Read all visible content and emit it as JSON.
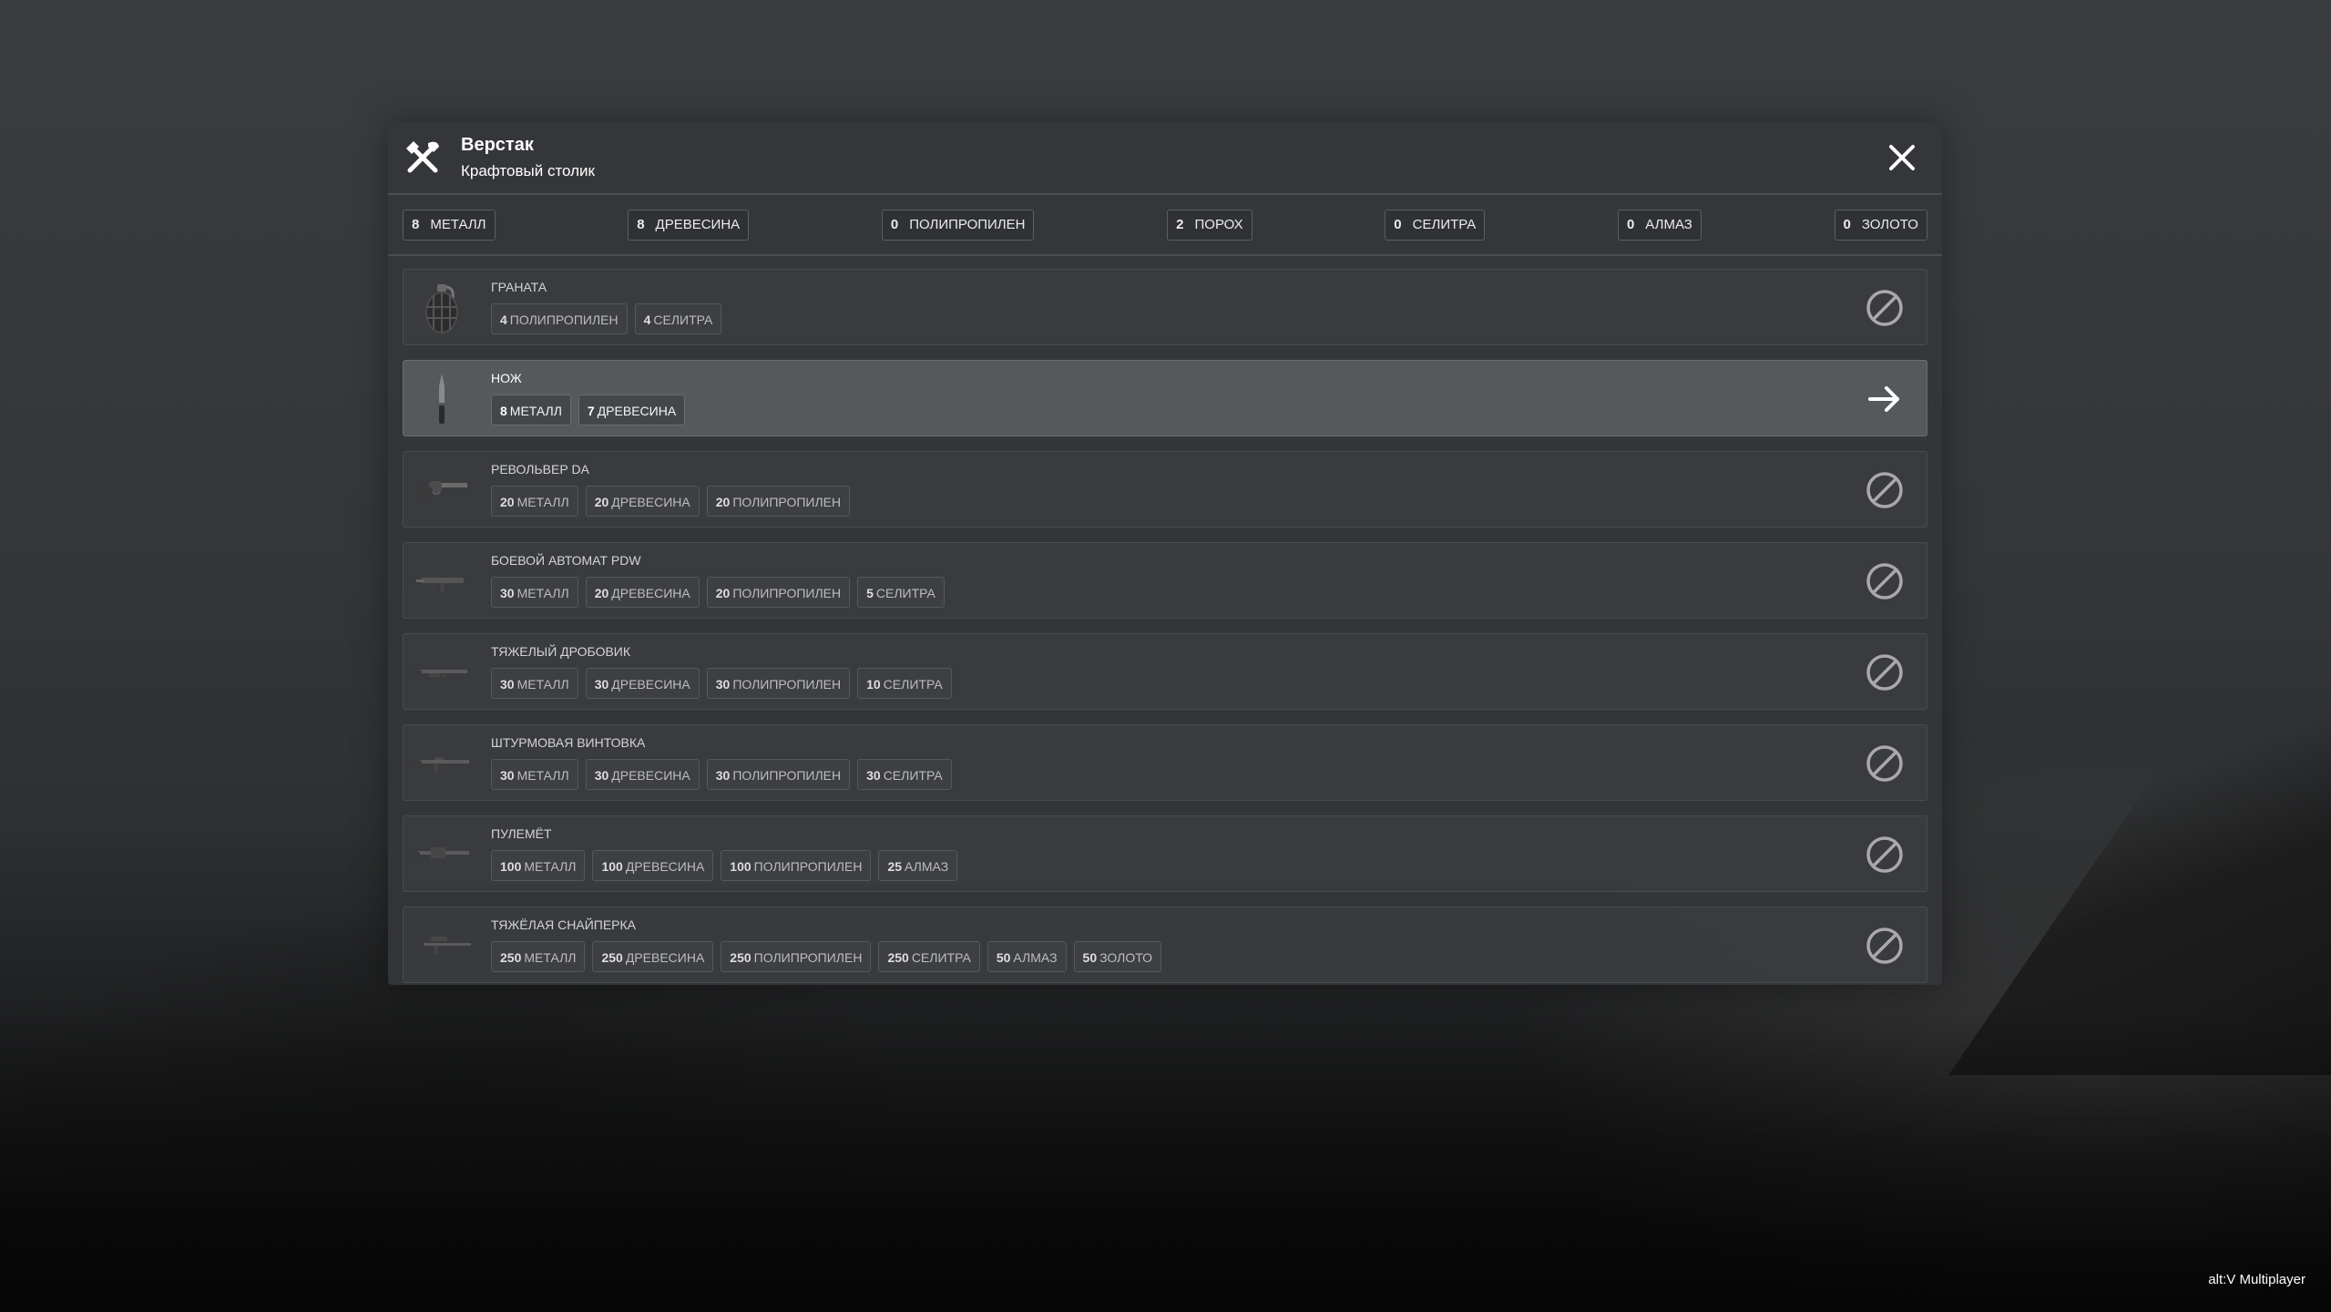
{
  "header": {
    "title": "Верстак",
    "subtitle": "Крафтовый столик",
    "icon": "tools-icon",
    "close_icon": "close-icon"
  },
  "resources": [
    {
      "count": "8",
      "label": "МЕТАЛЛ"
    },
    {
      "count": "8",
      "label": "ДРЕВЕСИНА"
    },
    {
      "count": "0",
      "label": "ПОЛИПРОПИЛЕН"
    },
    {
      "count": "2",
      "label": "ПОРОХ"
    },
    {
      "count": "0",
      "label": "СЕЛИТРА"
    },
    {
      "count": "0",
      "label": "АЛМАЗ"
    },
    {
      "count": "0",
      "label": "ЗОЛОТО"
    }
  ],
  "recipes": [
    {
      "name": "ГРАНАТА",
      "icon": "grenade-icon",
      "craftable": false,
      "costs": [
        {
          "amount": "4",
          "label": "ПОЛИПРОПИЛЕН"
        },
        {
          "amount": "4",
          "label": "СЕЛИТРА"
        }
      ]
    },
    {
      "name": "НОЖ",
      "icon": "knife-icon",
      "craftable": true,
      "costs": [
        {
          "amount": "8",
          "label": "МЕТАЛЛ"
        },
        {
          "amount": "7",
          "label": "ДРЕВЕСИНА"
        }
      ]
    },
    {
      "name": "РЕВОЛЬВЕР DA",
      "icon": "revolver-icon",
      "craftable": false,
      "costs": [
        {
          "amount": "20",
          "label": "МЕТАЛЛ"
        },
        {
          "amount": "20",
          "label": "ДРЕВЕСИНА"
        },
        {
          "amount": "20",
          "label": "ПОЛИПРОПИЛЕН"
        }
      ]
    },
    {
      "name": "БОЕВОЙ АВТОМАТ PDW",
      "icon": "smg-icon",
      "craftable": false,
      "costs": [
        {
          "amount": "30",
          "label": "МЕТАЛЛ"
        },
        {
          "amount": "20",
          "label": "ДРЕВЕСИНА"
        },
        {
          "amount": "20",
          "label": "ПОЛИПРОПИЛЕН"
        },
        {
          "amount": "5",
          "label": "СЕЛИТРА"
        }
      ]
    },
    {
      "name": "ТЯЖЕЛЫЙ ДРОБОВИК",
      "icon": "shotgun-icon",
      "craftable": false,
      "costs": [
        {
          "amount": "30",
          "label": "МЕТАЛЛ"
        },
        {
          "amount": "30",
          "label": "ДРЕВЕСИНА"
        },
        {
          "amount": "30",
          "label": "ПОЛИПРОПИЛЕН"
        },
        {
          "amount": "10",
          "label": "СЕЛИТРА"
        }
      ]
    },
    {
      "name": "ШТУРМОВАЯ ВИНТОВКА",
      "icon": "assault-rifle-icon",
      "craftable": false,
      "costs": [
        {
          "amount": "30",
          "label": "МЕТАЛЛ"
        },
        {
          "amount": "30",
          "label": "ДРЕВЕСИНА"
        },
        {
          "amount": "30",
          "label": "ПОЛИПРОПИЛЕН"
        },
        {
          "amount": "30",
          "label": "СЕЛИТРА"
        }
      ]
    },
    {
      "name": "ПУЛЕМЁТ",
      "icon": "machine-gun-icon",
      "craftable": false,
      "costs": [
        {
          "amount": "100",
          "label": "МЕТАЛЛ"
        },
        {
          "amount": "100",
          "label": "ДРЕВЕСИНА"
        },
        {
          "amount": "100",
          "label": "ПОЛИПРОПИЛЕН"
        },
        {
          "amount": "25",
          "label": "АЛМАЗ"
        }
      ]
    },
    {
      "name": "ТЯЖЁЛАЯ СНАЙПЕРКА",
      "icon": "sniper-rifle-icon",
      "craftable": false,
      "costs": [
        {
          "amount": "250",
          "label": "МЕТАЛЛ"
        },
        {
          "amount": "250",
          "label": "ДРЕВЕСИНА"
        },
        {
          "amount": "250",
          "label": "ПОЛИПРОПИЛЕН"
        },
        {
          "amount": "250",
          "label": "СЕЛИТРА"
        },
        {
          "amount": "50",
          "label": "АЛМАЗ"
        },
        {
          "amount": "50",
          "label": "ЗОЛОТО"
        }
      ]
    }
  ],
  "footer": {
    "watermark": "alt:V Multiplayer"
  }
}
